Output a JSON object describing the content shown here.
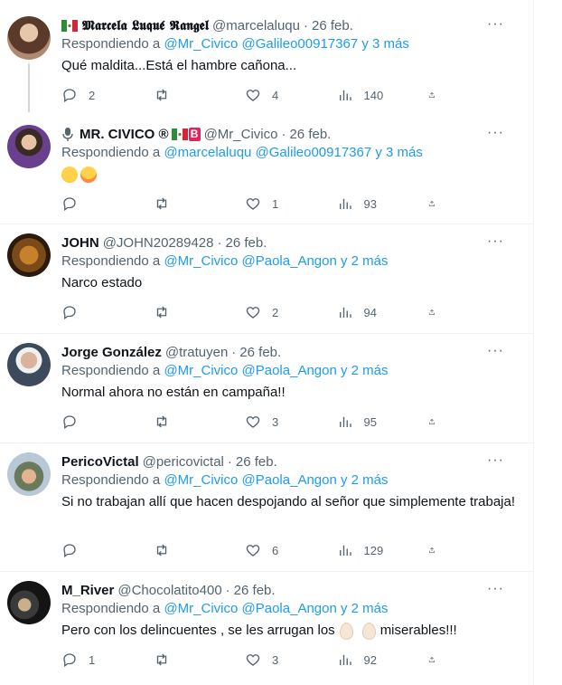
{
  "tweets": [
    {
      "name": "𝕸𝖆𝖗𝖈𝖊𝖑𝖆 𝕷𝖚𝖖𝖚𝖊́ 𝕽𝖆𝖓𝖌𝖊𝖑",
      "handle": "@marcelaluqu",
      "date": "26 feb.",
      "reply_prefix": "Respondiendo a",
      "mentions": "@Mr_Civico @Galileo00917367 y 3 más",
      "text": "Qué maldita...Está el hambre cañona...",
      "replies": "2",
      "retweets": "",
      "likes": "4",
      "views": "140"
    },
    {
      "name": "MR. CIVICO ®",
      "name_suffix": "B",
      "handle": "@Mr_Civico",
      "date": "26 feb.",
      "reply_prefix": "Respondiendo a",
      "mentions": "@marcelaluqu @Galileo00917367 y 3 más",
      "text": "",
      "replies": "",
      "retweets": "",
      "likes": "1",
      "views": "93"
    },
    {
      "name": "JOHN",
      "handle": "@JOHN20289428",
      "date": "26 feb.",
      "reply_prefix": "Respondiendo a",
      "mentions": "@Mr_Civico @Paola_Angon y 2 más",
      "text": "Narco estado",
      "replies": "",
      "retweets": "",
      "likes": "2",
      "views": "94"
    },
    {
      "name": "Jorge González",
      "handle": "@tratuyen",
      "date": "26 feb.",
      "reply_prefix": "Respondiendo a",
      "mentions": "@Mr_Civico @Paola_Angon y 2 más",
      "text": "Normal ahora no están en campaña!!",
      "replies": "",
      "retweets": "",
      "likes": "3",
      "views": "95"
    },
    {
      "name": "PericoVictal",
      "handle": "@pericovictal",
      "date": "26 feb.",
      "reply_prefix": "Respondiendo a",
      "mentions": "@Mr_Civico @Paola_Angon y 2 más",
      "text": "Si no trabajan allí que hacen despojando al señor que simplemente trabaja!",
      "replies": "",
      "retweets": "",
      "likes": "6",
      "views": "129"
    },
    {
      "name": "M_River",
      "handle": "@Chocolatito400",
      "date": "26 feb.",
      "reply_prefix": "Respondiendo a",
      "mentions": "@Mr_Civico @Paola_Angon y 2 más",
      "text_a": "Pero con los delincuentes , se les arrugan los",
      "text_b": "miserables!!!",
      "replies": "1",
      "retweets": "",
      "likes": "3",
      "views": "92"
    }
  ],
  "icons": {
    "more": "more-dots-icon",
    "reply": "reply-icon",
    "retweet": "retweet-icon",
    "like": "heart-icon",
    "views": "views-icon",
    "share": "share-icon"
  },
  "separator": "·",
  "more_glyph": "···",
  "colors": {
    "link": "#1d9bf0",
    "muted": "#536471",
    "text": "#0f1419"
  }
}
